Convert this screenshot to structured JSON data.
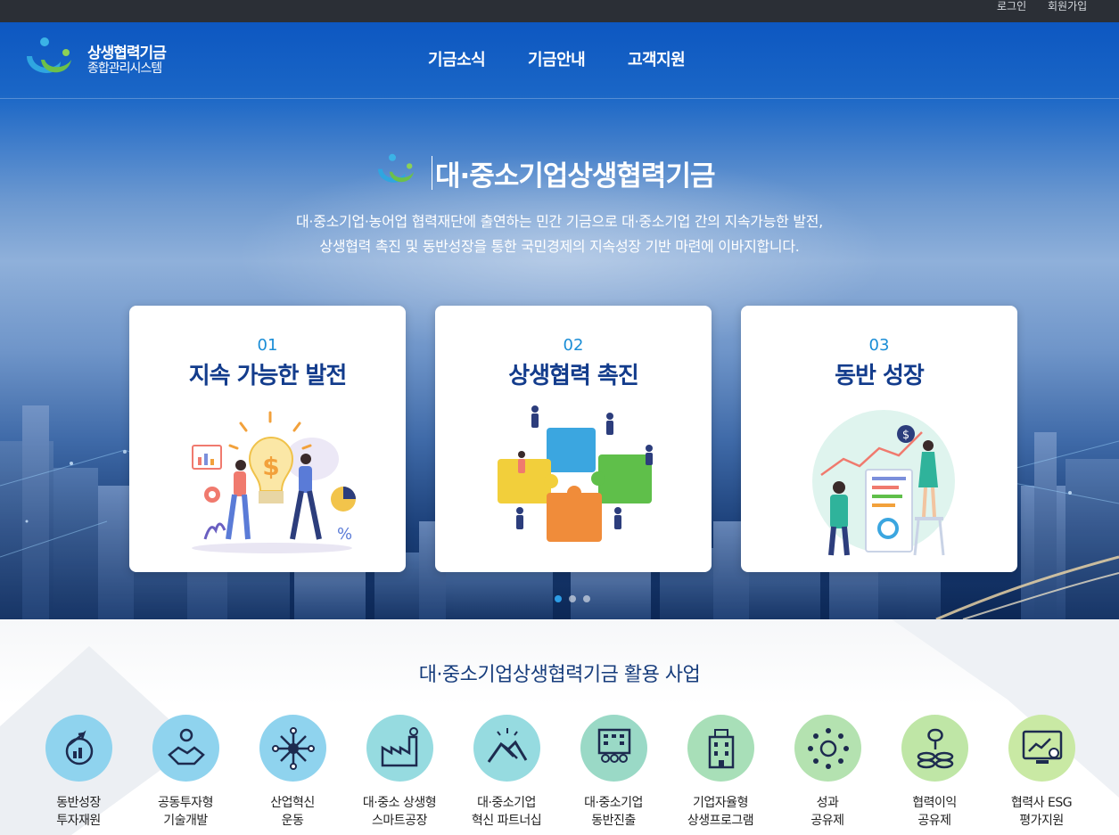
{
  "topbar": {
    "login": "로그인",
    "signup": "회원가입"
  },
  "brand": {
    "title": "상생협력기금",
    "subtitle": "종합관리시스템"
  },
  "nav": [
    "기금소식",
    "기금안내",
    "고객지원"
  ],
  "hero": {
    "title": "대·중소기업상생협력기금",
    "desc_line1": "대·중소기업·농어업 협력재단에 출연하는 민간 기금으로 대·중소기업 간의 지속가능한 발전,",
    "desc_line2": "상생협력 촉진 및 동반성장을 통한 국민경제의 지속성장 기반 마련에 이바지합니다."
  },
  "cards": [
    {
      "num": "01",
      "title": "지속 가능한 발전"
    },
    {
      "num": "02",
      "title": "상생협력 촉진"
    },
    {
      "num": "03",
      "title": "동반 성장"
    }
  ],
  "carousel": {
    "total": 3,
    "active": 1
  },
  "business": {
    "title": "대·중소기업상생협력기금 활용 사업",
    "items": [
      {
        "line1": "동반성장",
        "line2": "투자재원",
        "icon": "growth-chart-icon",
        "color": "#8fd3ee"
      },
      {
        "line1": "공동투자형",
        "line2": "기술개발",
        "icon": "handshake-idea-icon",
        "color": "#8fd3ee"
      },
      {
        "line1": "산업혁신",
        "line2": "운동",
        "icon": "network-nodes-icon",
        "color": "#8fd3ee"
      },
      {
        "line1": "대·중소 상생형",
        "line2": "스마트공장",
        "icon": "smart-factory-icon",
        "color": "#96dbe0"
      },
      {
        "line1": "대·중소기업",
        "line2": "혁신 파트너십",
        "icon": "partnership-hands-icon",
        "color": "#96dbe0"
      },
      {
        "line1": "대·중소기업",
        "line2": "동반진출",
        "icon": "team-building-icon",
        "color": "#9ad9c6"
      },
      {
        "line1": "기업자율형",
        "line2": "상생프로그램",
        "icon": "corporate-building-icon",
        "color": "#a8dfb8"
      },
      {
        "line1": "성과",
        "line2": "공유제",
        "icon": "sharing-network-icon",
        "color": "#b4e2b0"
      },
      {
        "line1": "협력이익",
        "line2": "공유제",
        "icon": "profit-coins-icon",
        "color": "#bfe6a6"
      },
      {
        "line1": "협력사 ESG",
        "line2": "평가지원",
        "icon": "esg-monitor-icon",
        "color": "#c9e9a4"
      }
    ]
  }
}
